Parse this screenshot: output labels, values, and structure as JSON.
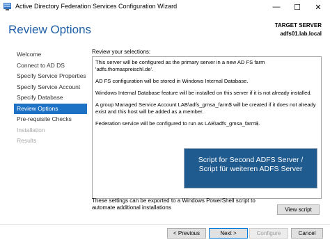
{
  "window": {
    "title": "Active Directory Federation Services Configuration Wizard",
    "controls": {
      "minimize": "—",
      "maximize": "☐",
      "close": "✕"
    }
  },
  "header": {
    "page_title": "Review Options",
    "target_label": "TARGET SERVER",
    "target_value": "adfs01.lab.local"
  },
  "nav": {
    "items": [
      {
        "label": "Welcome",
        "state": "normal"
      },
      {
        "label": "Connect to AD DS",
        "state": "normal"
      },
      {
        "label": "Specify Service Properties",
        "state": "normal"
      },
      {
        "label": "Specify Service Account",
        "state": "normal"
      },
      {
        "label": "Specify Database",
        "state": "normal"
      },
      {
        "label": "Review Options",
        "state": "active"
      },
      {
        "label": "Pre-requisite Checks",
        "state": "normal"
      },
      {
        "label": "Installation",
        "state": "disabled"
      },
      {
        "label": "Results",
        "state": "disabled"
      }
    ]
  },
  "review": {
    "label": "Review your selections:",
    "lines": [
      "This server will be configured as the primary server in a new AD FS farm 'adfs.thomaspreischl.de'.",
      "AD FS configuration will be stored in Windows Internal Database.",
      "Windows Internal Database feature will be installed on this server if it is not already installed.",
      "A group Managed Service Account LAB\\adfs_gmsa_farm$ will be created if it does not already exist and this host will be added as a member.",
      "Federation service will be configured to run as LAB\\adfs_gmsa_farm$."
    ]
  },
  "overlay": {
    "line1": "Script for Second ADFS Server /",
    "line2": "Script für weiteren ADFS Server"
  },
  "export": {
    "text": "These settings can be exported to a Windows PowerShell script to automate additional installations",
    "view_script": "View script"
  },
  "footer": {
    "previous": "< Previous",
    "next": "Next >",
    "configure": "Configure",
    "cancel": "Cancel"
  },
  "colors": {
    "accent": "#1e72c6",
    "title": "#1e5fa6",
    "overlay": "#1f5b8f"
  }
}
